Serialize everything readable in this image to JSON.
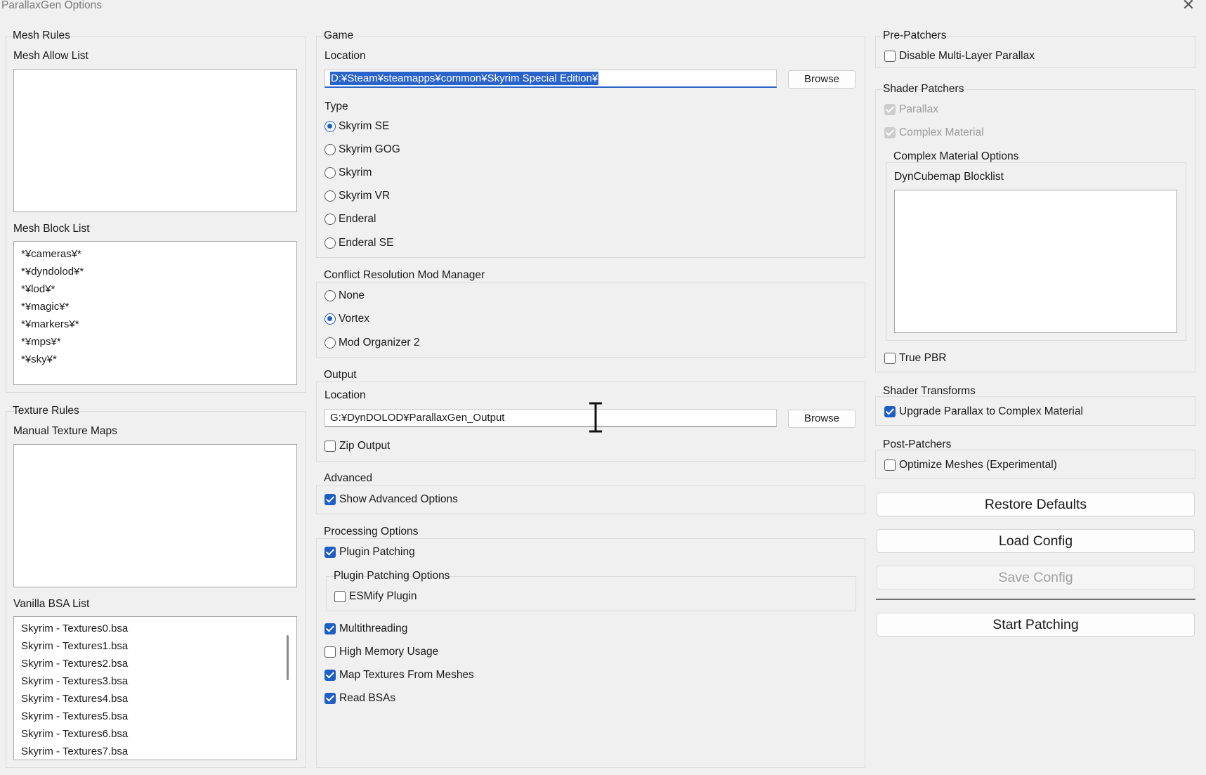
{
  "window": {
    "title": "ParallaxGen Options"
  },
  "mesh_rules": {
    "title": "Mesh Rules",
    "allow_label": "Mesh Allow List",
    "allow_items": [],
    "block_label": "Mesh Block List",
    "block_items": [
      "*¥cameras¥*",
      "*¥dyndolod¥*",
      "*¥lod¥*",
      "*¥magic¥*",
      "*¥markers¥*",
      "*¥mps¥*",
      "*¥sky¥*"
    ]
  },
  "texture_rules": {
    "title": "Texture Rules",
    "manual_label": "Manual Texture Maps",
    "manual_items": [],
    "vanilla_label": "Vanilla BSA List",
    "vanilla_items": [
      "Skyrim - Textures0.bsa",
      "Skyrim - Textures1.bsa",
      "Skyrim - Textures2.bsa",
      "Skyrim - Textures3.bsa",
      "Skyrim - Textures4.bsa",
      "Skyrim - Textures5.bsa",
      "Skyrim - Textures6.bsa",
      "Skyrim - Textures7.bsa"
    ]
  },
  "game": {
    "title": "Game",
    "location_label": "Location",
    "location_value": "D:¥Steam¥steamapps¥common¥Skyrim Special Edition¥",
    "browse_label": "Browse",
    "type_label": "Type",
    "types": [
      "Skyrim SE",
      "Skyrim GOG",
      "Skyrim",
      "Skyrim VR",
      "Enderal",
      "Enderal SE"
    ],
    "selected_type": "Skyrim SE"
  },
  "conflict": {
    "title": "Conflict Resolution Mod Manager",
    "options": [
      "None",
      "Vortex",
      "Mod Organizer 2"
    ],
    "selected": "Vortex"
  },
  "output": {
    "title": "Output",
    "location_label": "Location",
    "location_value": "G:¥DynDOLOD¥ParallaxGen_Output",
    "browse_label": "Browse",
    "zip_label": "Zip Output",
    "zip_checked": false
  },
  "advanced": {
    "title": "Advanced",
    "show_label": "Show Advanced Options",
    "show_checked": true
  },
  "processing": {
    "title": "Processing Options",
    "plugin_patching_label": "Plugin Patching",
    "plugin_patching_checked": true,
    "plugin_options_title": "Plugin Patching Options",
    "esmify_label": "ESMify Plugin",
    "esmify_checked": false,
    "multithreading_label": "Multithreading",
    "multithreading_checked": true,
    "high_memory_label": "High Memory Usage",
    "high_memory_checked": false,
    "map_textures_label": "Map Textures From Meshes",
    "map_textures_checked": true,
    "read_bsas_label": "Read BSAs",
    "read_bsas_checked": true
  },
  "pre_patchers": {
    "title": "Pre-Patchers",
    "disable_mlp_label": "Disable Multi-Layer Parallax",
    "disable_mlp_checked": false
  },
  "shader_patchers": {
    "title": "Shader Patchers",
    "parallax_label": "Parallax",
    "complex_label": "Complex Material",
    "cm_options_title": "Complex Material Options",
    "blocklist_label": "DynCubemap Blocklist",
    "blocklist_items": [],
    "true_pbr_label": "True PBR",
    "true_pbr_checked": false
  },
  "shader_transforms": {
    "title": "Shader Transforms",
    "upgrade_label": "Upgrade Parallax to Complex Material",
    "upgrade_checked": true
  },
  "post_patchers": {
    "title": "Post-Patchers",
    "optimize_label": "Optimize Meshes (Experimental)",
    "optimize_checked": false
  },
  "actions": {
    "restore_label": "Restore Defaults",
    "load_label": "Load Config",
    "save_label": "Save Config",
    "start_label": "Start Patching"
  },
  "colors": {
    "accent": "#1f5fc4",
    "selection": "#2a63c9",
    "background": "#f0f0f0"
  }
}
